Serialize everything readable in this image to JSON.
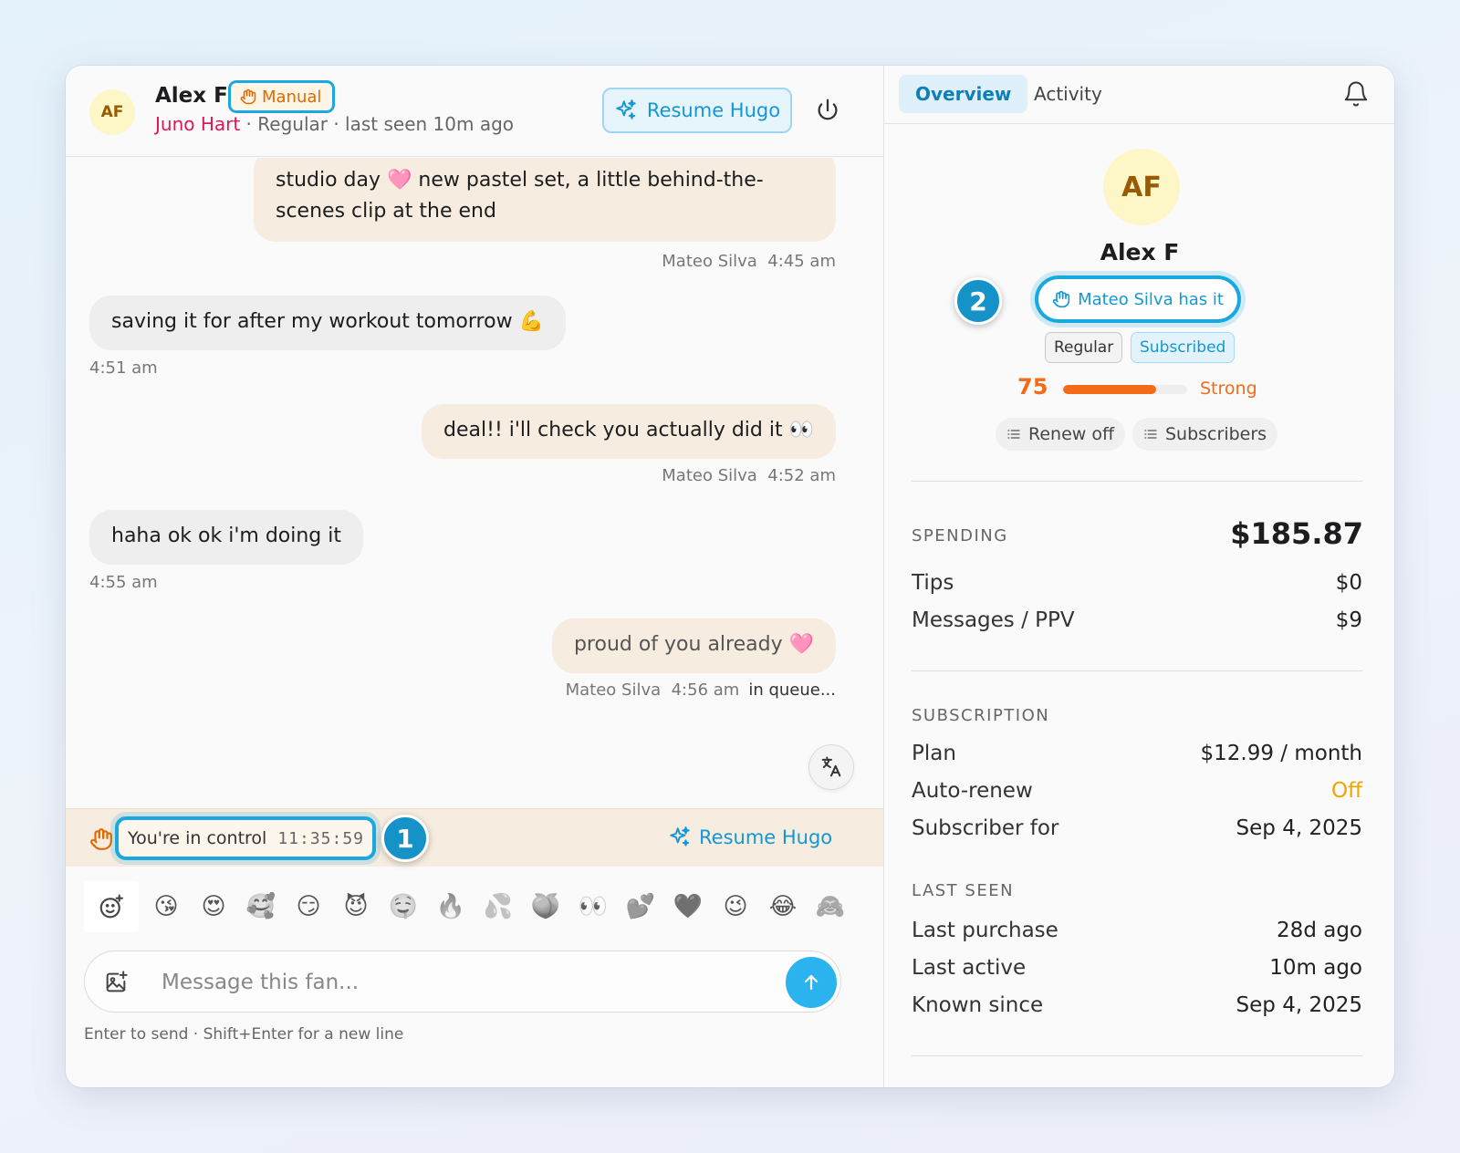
{
  "chat": {
    "header": {
      "avatar_initials": "AF",
      "fan_name": "Alex F",
      "mode_badge": "Manual",
      "creator_name": "Juno Hart",
      "status_rest": " · Regular · last seen 10m ago",
      "resume_label": "Resume Hugo"
    },
    "messages": [
      {
        "direction": "out",
        "text": "studio day 🩷 new pastel set, a little behind-the-scenes clip at the end",
        "sender": "Mateo Silva",
        "time": "4:45 am"
      },
      {
        "direction": "in",
        "text": "saving it for after my workout tomorrow 💪",
        "time": "4:51 am"
      },
      {
        "direction": "out",
        "text": "deal!! i'll check you actually did it 👀",
        "sender": "Mateo Silva",
        "time": "4:52 am"
      },
      {
        "direction": "in",
        "text": "haha ok ok i'm doing it",
        "time": "4:55 am"
      },
      {
        "direction": "out",
        "text": "proud of you already 🩷",
        "sender": "Mateo Silva",
        "time": "4:56 am",
        "status": "in queue..."
      }
    ],
    "control_bar": {
      "label": "You're in control",
      "timer": "11:35:59",
      "step": "1",
      "resume_label": "Resume Hugo"
    },
    "emojis": [
      "😘",
      "😍",
      "🥰",
      "😏",
      "😈",
      "🤤",
      "🔥",
      "💦",
      "🍑",
      "👀",
      "💕",
      "🖤",
      "😉",
      "😂",
      "🙈"
    ],
    "composer": {
      "placeholder": "Message this fan...",
      "hint": "Enter to send · Shift+Enter for a new line"
    }
  },
  "panel": {
    "tabs": [
      "Overview",
      "Activity"
    ],
    "profile": {
      "avatar_initials": "AF",
      "name": "Alex F",
      "owner": "Mateo Silva has it",
      "step": "2",
      "tags": [
        "Regular",
        "Subscribed"
      ],
      "score": 75,
      "score_label": "Strong",
      "chips": [
        "Renew off",
        "Subscribers"
      ]
    },
    "spending": {
      "title": "SPENDING",
      "total": "$185.87",
      "rows": [
        {
          "label": "Tips",
          "value": "$0"
        },
        {
          "label": "Messages / PPV",
          "value": "$9"
        }
      ]
    },
    "subscription": {
      "title": "SUBSCRIPTION",
      "rows": [
        {
          "label": "Plan",
          "value": "$12.99 / month"
        },
        {
          "label": "Auto-renew",
          "value": "Off"
        },
        {
          "label": "Subscriber for",
          "value": "Sep 4, 2025"
        }
      ]
    },
    "last_seen": {
      "title": "LAST SEEN",
      "rows": [
        {
          "label": "Last purchase",
          "value": "28d ago"
        },
        {
          "label": "Last active",
          "value": "10m ago"
        },
        {
          "label": "Known since",
          "value": "Sep 4, 2025"
        }
      ]
    }
  },
  "colors": {
    "accent": "#1ba8e0",
    "creator": "#e0165a",
    "warning": "#f36b16",
    "off": "#f2a500",
    "outgoing_bubble": "#f6ecdf"
  }
}
